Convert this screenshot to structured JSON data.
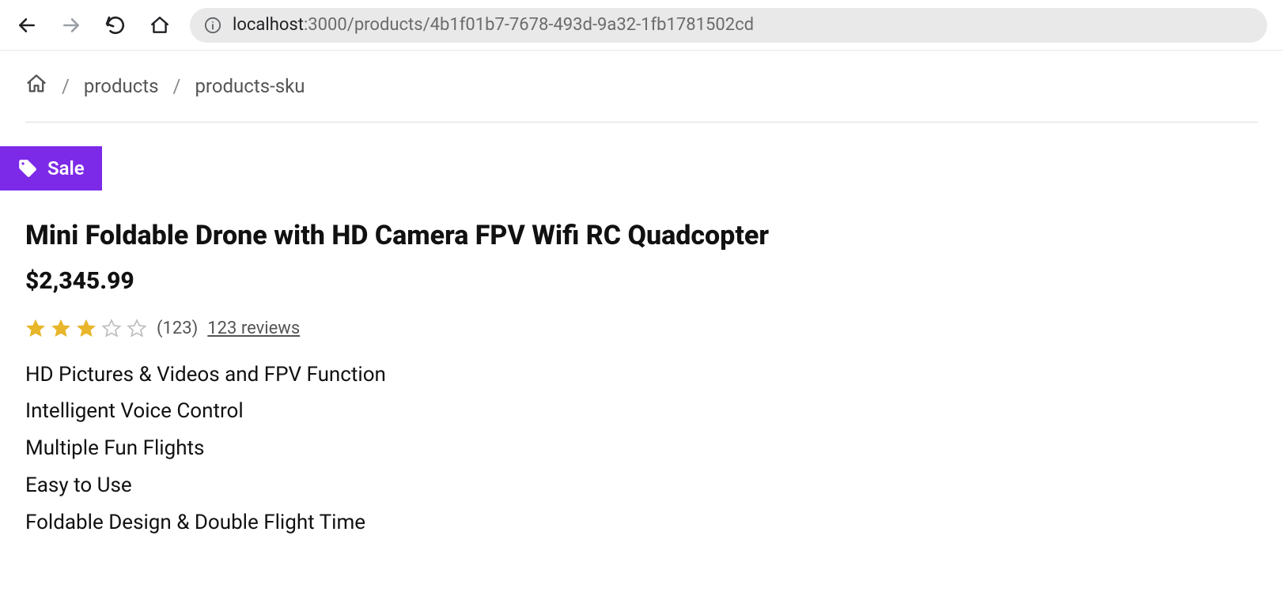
{
  "browser": {
    "url_host_dark": "localhost",
    "url_host_light": ":3000",
    "url_path": "/products/4b1f01b7-7678-493d-9a32-1fb1781502cd"
  },
  "breadcrumb": {
    "items": [
      {
        "label": "products"
      },
      {
        "label": "products-sku"
      }
    ]
  },
  "badge": {
    "label": "Sale",
    "color": "#7c2ae8"
  },
  "product": {
    "title": "Mini Foldable Drone with HD Camera FPV Wifi RC Quadcopter",
    "price": "$2,345.99",
    "rating_filled": 3,
    "rating_total": 5,
    "rating_count_paren": "(123)",
    "reviews_link_label": "123 reviews",
    "features": [
      "HD Pictures & Videos and FPV Function",
      "Intelligent Voice Control",
      "Multiple Fun Flights",
      "Easy to Use",
      "Foldable Design & Double Flight Time"
    ]
  }
}
